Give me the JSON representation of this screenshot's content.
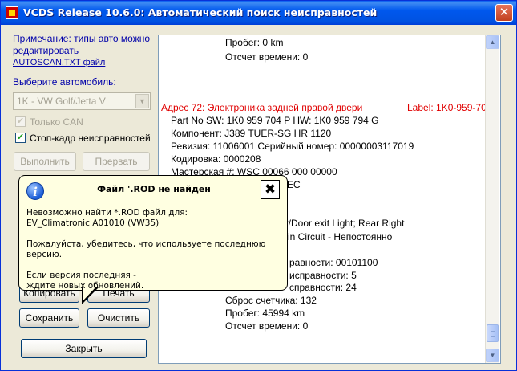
{
  "window": {
    "title": "VCDS Release 10.6.0:  Автоматический поиск неисправностей"
  },
  "left": {
    "note": "Примечание: типы авто можно редактировать",
    "note_link": "AUTOSCAN.TXT файл",
    "choose_label": "Выберите автомобиль:",
    "car_value": "1K - VW Golf/Jetta V",
    "only_can": {
      "label": "Только CAN",
      "checked": true,
      "disabled": true
    },
    "freeze_frame": {
      "label": "Стоп-кадр неисправностей",
      "checked": true,
      "disabled": false
    },
    "buttons": {
      "run": "Выполнить",
      "stop": "Прервать",
      "copy": "Копировать",
      "print": "Печать",
      "save": "Сохранить",
      "clear": "Очистить",
      "close": "Закрыть"
    }
  },
  "tooltip": {
    "title": "Файл '.ROD не найден",
    "close_glyph": "✖",
    "p1": "Невозможно найти *.ROD файл для:\nEV_Climatronic A01010 (VW35)",
    "p2": "Пожалуйста, убедитесь, что используете последнюю версию.",
    "p3": "Если версия последняя -\nждите новых обновлений."
  },
  "log": {
    "top_lines": [
      "Пробег: 0 km",
      "Отсчет времени: 0"
    ],
    "address_line": "Адрес 72:  Электроника задней правой двери",
    "label_line": "Label: 1K0-959-70",
    "lines": [
      "Part No SW: 1K0 959 704 P    HW: 1K0 959 794 G",
      "Компонент: J389   TUER-SG HR   1120",
      "Ревизия: 11006001    Серийный номер: 00000003117019",
      "Кодировка: 0000208",
      "Мастерская #: WSC 00066 000 00000"
    ],
    "partial_lines": [
      "EC",
      "ght/Door exit Light; Rear Right",
      "ult in Circuit - Непостоянно",
      "равности: 00101100",
      "исправности: 5",
      "справности: 24"
    ],
    "bottom_lines": [
      "Сброс счетчика: 132",
      "Пробег: 45994 km",
      "Отсчет времени: 0"
    ]
  }
}
